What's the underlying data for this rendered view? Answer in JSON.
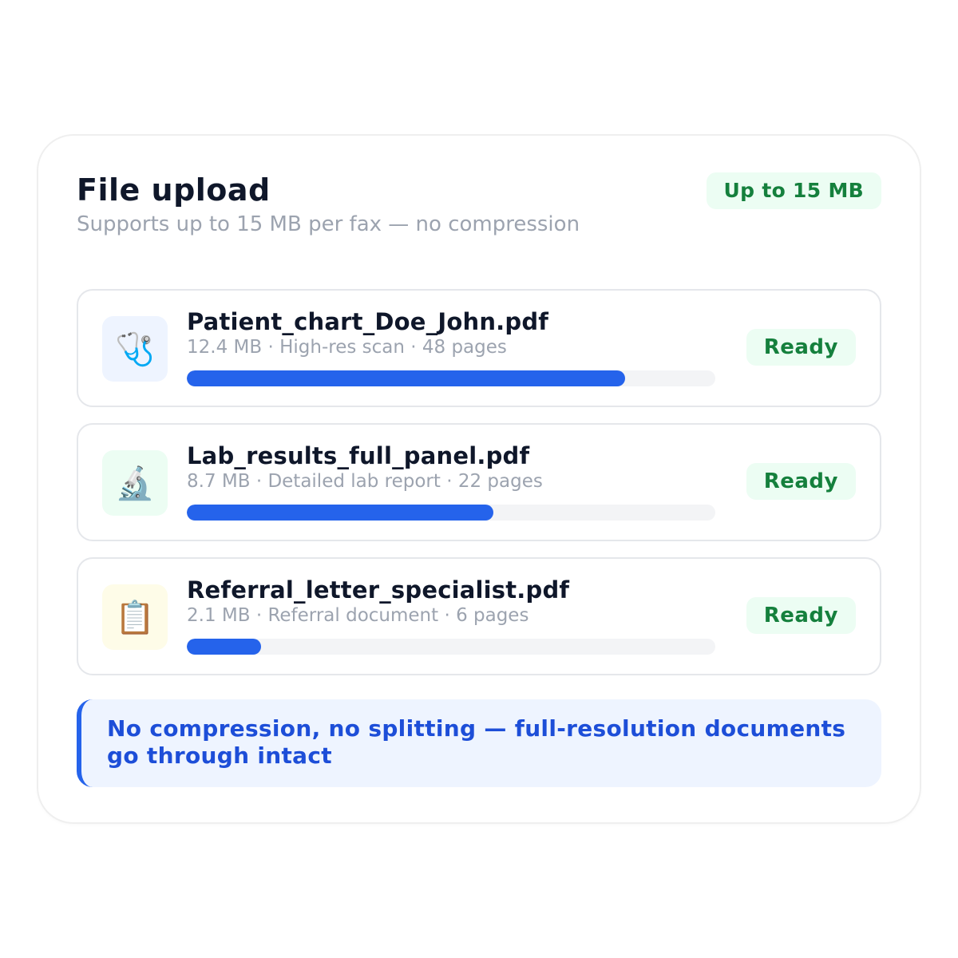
{
  "header": {
    "title": "File upload",
    "subtitle": "Supports up to 15 MB per fax — no compression",
    "limit_badge": "Up to 15 MB"
  },
  "files": [
    {
      "name": "Patient_chart_Doe_John.pdf",
      "meta": "12.4 MB · High-res scan · 48 pages",
      "status": "Ready",
      "icon": "stethoscope-icon",
      "icon_glyph": "🩺",
      "icon_bg": "#eef4ff",
      "progress": 0.83
    },
    {
      "name": "Lab_results_full_panel.pdf",
      "meta": "8.7 MB · Detailed lab report · 22 pages",
      "status": "Ready",
      "icon": "microscope-icon",
      "icon_glyph": "🔬",
      "icon_bg": "#ecfdf3",
      "progress": 0.58
    },
    {
      "name": "Referral_letter_specialist.pdf",
      "meta": "2.1 MB · Referral document · 6 pages",
      "status": "Ready",
      "icon": "clipboard-icon",
      "icon_glyph": "📋",
      "icon_bg": "#fefce8",
      "progress": 0.14
    }
  ],
  "notice": {
    "text": "No compression, no splitting — full-resolution documents go through intact"
  },
  "colors": {
    "accent": "#2563eb",
    "success": "#15803d",
    "success_bg": "#ecfdf3",
    "notice_bg": "#eef4ff",
    "notice_text": "#1d4ed8"
  }
}
